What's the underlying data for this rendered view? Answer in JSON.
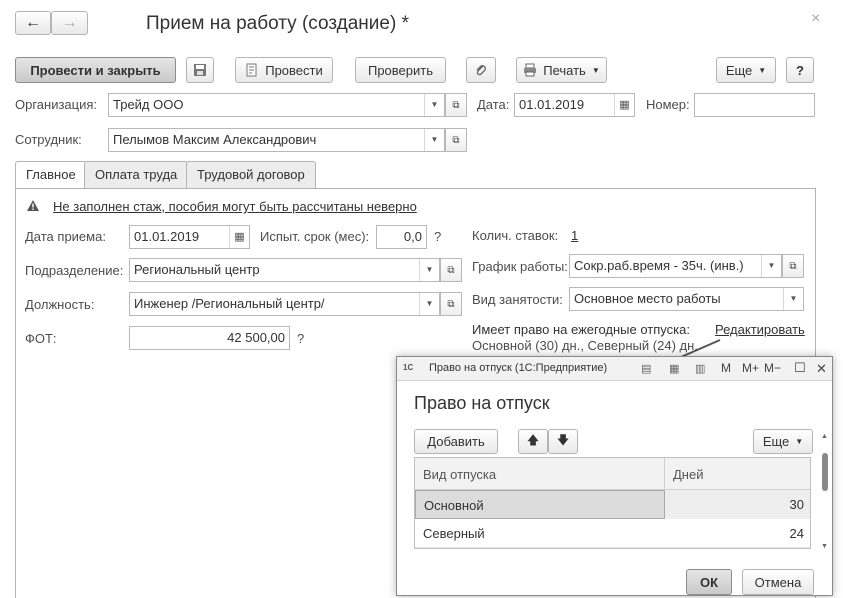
{
  "window": {
    "title": "Прием на работу (создание) *",
    "nav_back": "←",
    "nav_forward": "→",
    "close": "×"
  },
  "toolbar": {
    "post_close": "Провести и закрыть",
    "post": "Провести",
    "check": "Проверить",
    "print": "Печать",
    "more": "Еще",
    "help": "?"
  },
  "header": {
    "org_label": "Организация:",
    "org_value": "Трейд ООО",
    "date_label": "Дата:",
    "date_value": "01.01.2019",
    "number_label": "Номер:",
    "number_value": "",
    "employee_label": "Сотрудник:",
    "employee_value": "Пелымов Максим Александрович"
  },
  "tabs": [
    "Главное",
    "Оплата труда",
    "Трудовой договор"
  ],
  "main": {
    "warning": "Не заполнен стаж, пособия могут быть рассчитаны неверно",
    "hire_date_label": "Дата приема:",
    "hire_date_value": "01.01.2019",
    "probation_label": "Испыт. срок (мес):",
    "probation_value": "0,0",
    "question": "?",
    "dept_label": "Подразделение:",
    "dept_value": "Региональный центр",
    "position_label": "Должность:",
    "position_value": "Инженер /Региональный центр/",
    "fot_label": "ФОТ:",
    "fot_value": "42 500,00",
    "rates_label": "Колич. ставок:",
    "rates_value": "1",
    "schedule_label": "График работы:",
    "schedule_value": "Сокр.раб.время  - 35ч. (инв.)",
    "employment_label": "Вид занятости:",
    "employment_value": "Основное место работы",
    "leave_title": "Имеет право на ежегодные отпуска:",
    "leave_edit": "Редактировать",
    "leave_value": "Основной (30) дн., Северный (24) дн."
  },
  "popup": {
    "window_title": "Право на отпуск  (1С:Предприятие)",
    "app_icon": "1С",
    "heading": "Право на отпуск",
    "add": "Добавить",
    "more": "Еще",
    "columns": [
      "Вид отпуска",
      "Дней"
    ],
    "rows": [
      {
        "kind": "Основной",
        "days": "30"
      },
      {
        "kind": "Северный",
        "days": "24"
      }
    ],
    "ok": "ОК",
    "cancel": "Отмена",
    "title_buttons": [
      "M",
      "M+",
      "M−"
    ],
    "close": "✕"
  },
  "colors": {
    "border": "#b8b8b8",
    "selected_row": "#dcdcdc",
    "arrow": "#555555"
  }
}
